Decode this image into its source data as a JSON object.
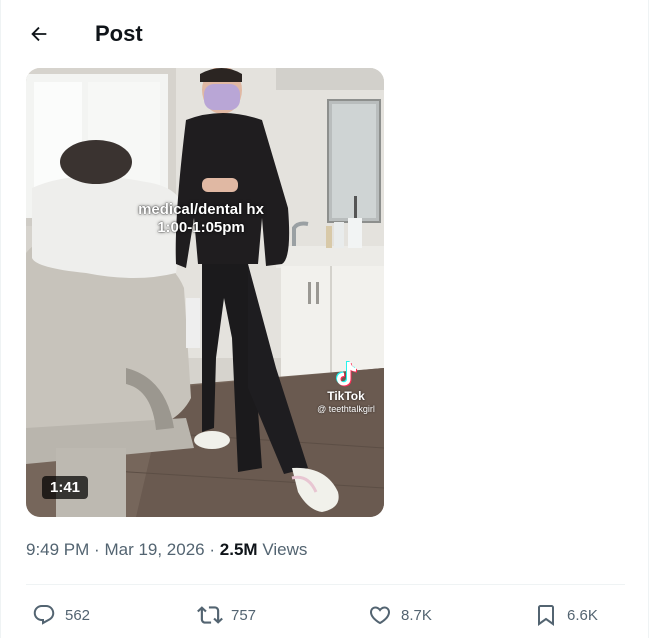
{
  "header": {
    "title": "Post",
    "back_icon": "arrow-left-icon"
  },
  "post": {
    "video": {
      "overlay_line1": "medical/dental hx",
      "overlay_line2": "1:00-1:05pm",
      "watermark_name": "TikTok",
      "watermark_handle": "@ teethtalkgirl",
      "duration": "1:41"
    },
    "time": "9:49 PM",
    "separator": "·",
    "date": "Mar 19, 2026",
    "views_count": "2.5M",
    "views_label": "Views"
  },
  "actions": {
    "replies": {
      "icon": "reply-icon",
      "count": "562"
    },
    "reposts": {
      "icon": "repost-icon",
      "count": "757"
    },
    "likes": {
      "icon": "heart-icon",
      "count": "8.7K"
    },
    "bookmarks": {
      "icon": "bookmark-icon",
      "count": "6.6K"
    }
  },
  "colors": {
    "text_primary": "#0f1419",
    "text_secondary": "#536471",
    "divider": "#eff3f4"
  }
}
